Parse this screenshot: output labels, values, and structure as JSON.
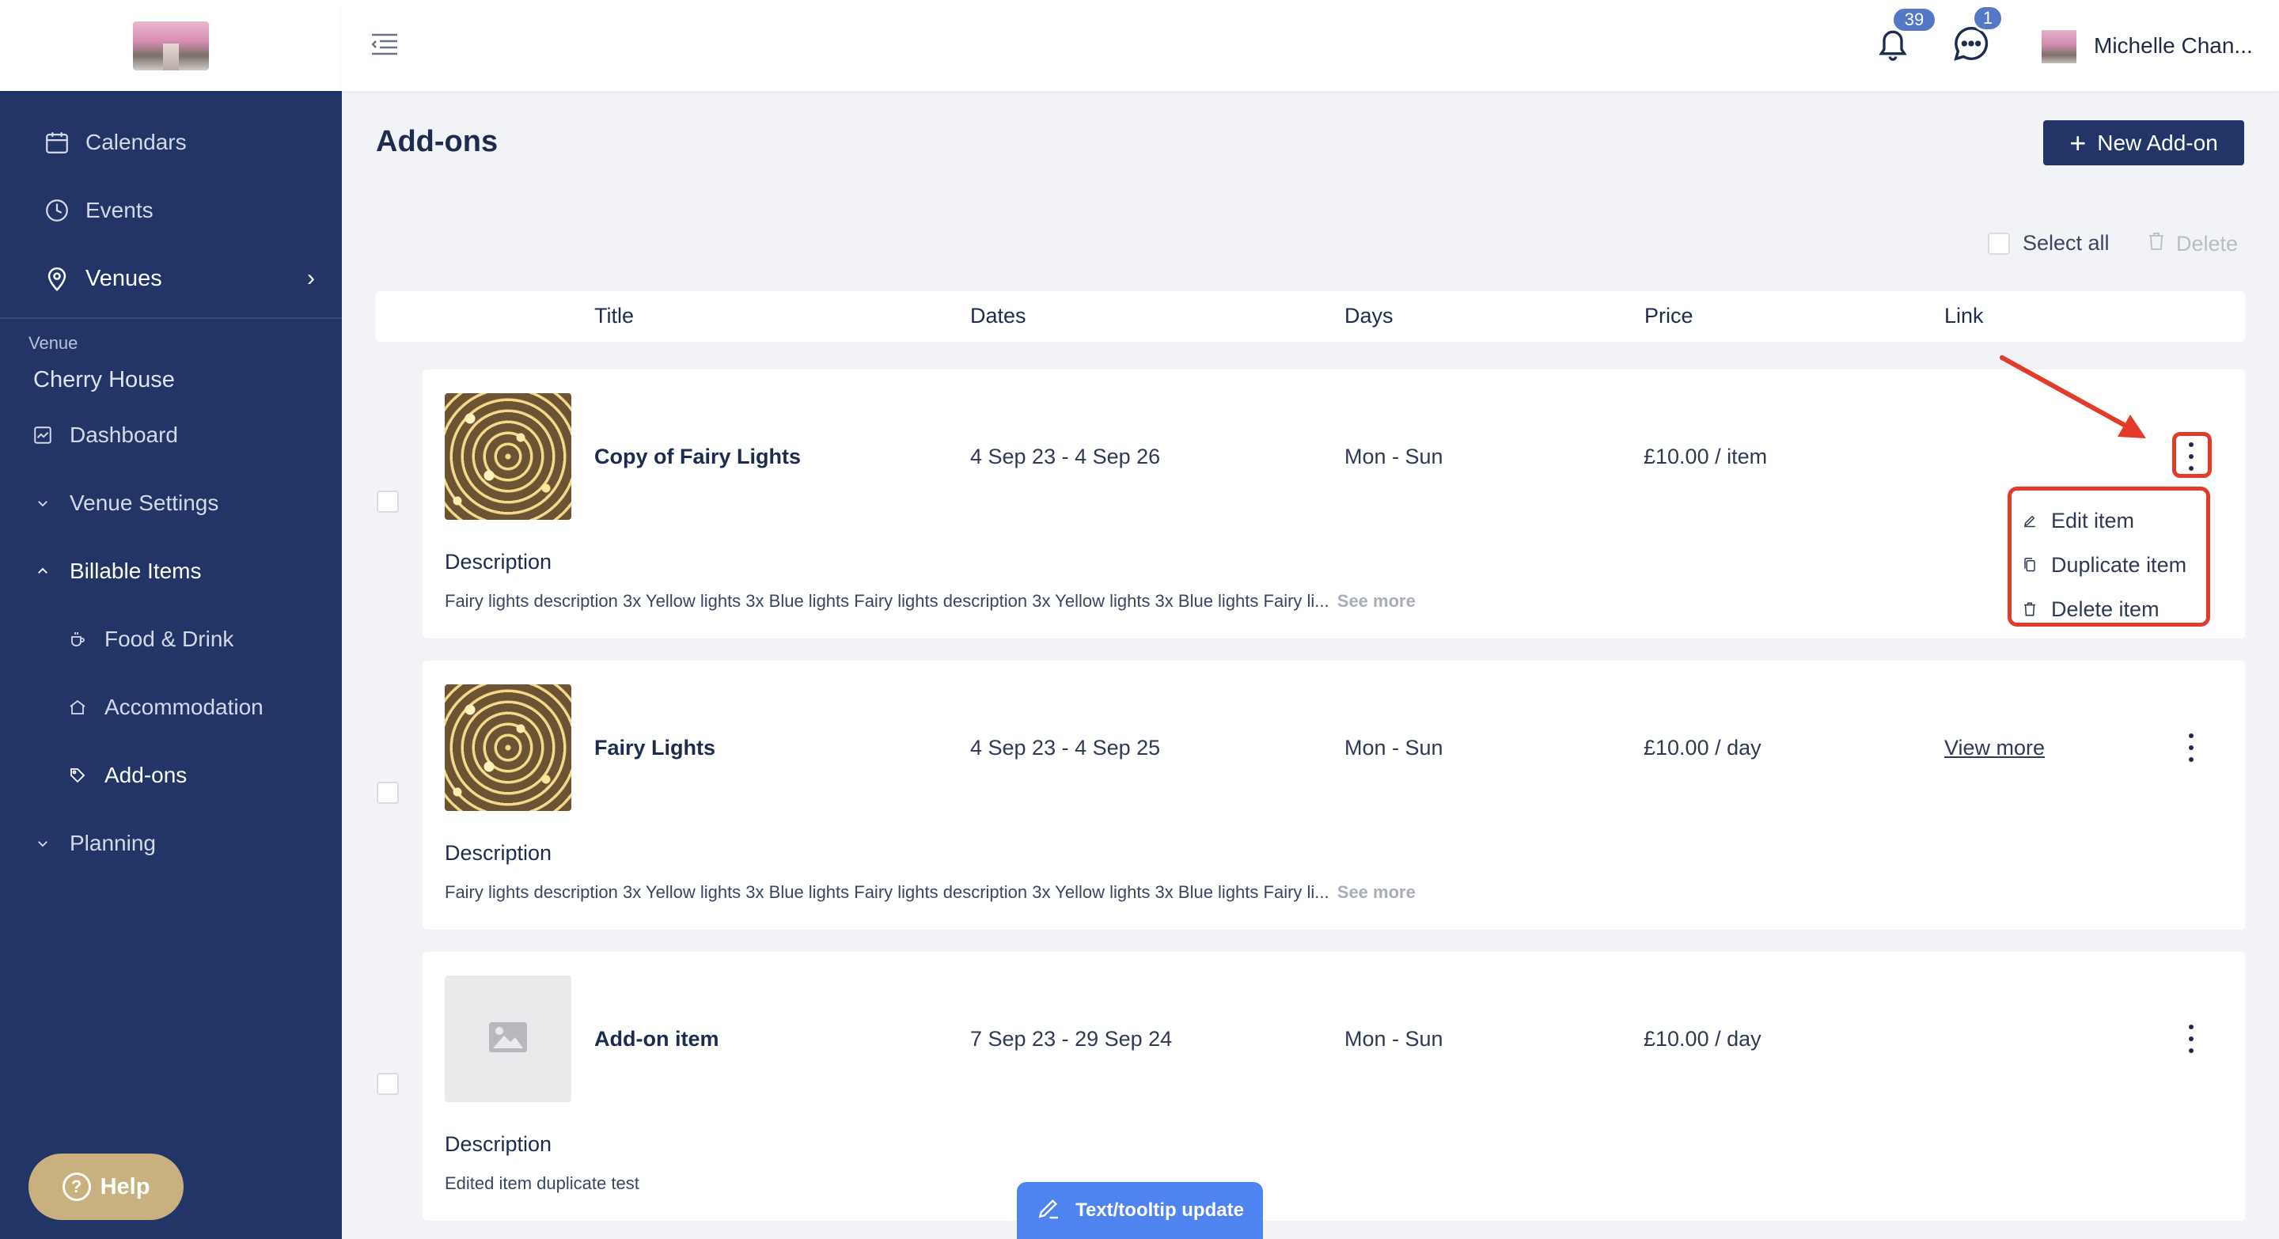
{
  "sidebar": {
    "nav": [
      {
        "label": "Calendars",
        "icon": "calendar-icon"
      },
      {
        "label": "Events",
        "icon": "clock-icon"
      },
      {
        "label": "Venues",
        "icon": "location-pin-icon"
      }
    ],
    "venue_label": "Venue",
    "venue_name": "Cherry House",
    "items": [
      {
        "label": "Dashboard",
        "icon": "chart-icon"
      },
      {
        "label": "Venue Settings",
        "icon": "chevron-down-icon"
      },
      {
        "label": "Billable Items",
        "icon": "chevron-up-icon"
      },
      {
        "label": "Food & Drink",
        "icon": "coffee-icon"
      },
      {
        "label": "Accommodation",
        "icon": "home-icon"
      },
      {
        "label": "Add-ons",
        "icon": "tag-icon"
      },
      {
        "label": "Planning",
        "icon": "chevron-down-icon"
      }
    ],
    "help_label": "Help"
  },
  "topbar": {
    "notifications_count": "39",
    "messages_count": "1",
    "user_name": "Michelle Chan..."
  },
  "page": {
    "title": "Add-ons",
    "new_button": "New Add-on",
    "select_all": "Select all",
    "delete": "Delete"
  },
  "table": {
    "columns": [
      "Title",
      "Dates",
      "Days",
      "Price",
      "Link"
    ],
    "rows": [
      {
        "title": "Copy of Fairy Lights",
        "dates": "4 Sep 23 - 4 Sep 26",
        "days": "Mon - Sun",
        "price": "£10.00 / item",
        "link": "",
        "description_label": "Description",
        "description": "Fairy lights description 3x Yellow lights 3x Blue lights Fairy lights description 3x Yellow lights 3x Blue lights Fairy li...",
        "see_more": "See more"
      },
      {
        "title": "Fairy Lights",
        "dates": "4 Sep 23 - 4 Sep 25",
        "days": "Mon - Sun",
        "price": "£10.00 / day",
        "link": "View more",
        "description_label": "Description",
        "description": "Fairy lights description 3x Yellow lights 3x Blue lights Fairy lights description 3x Yellow lights 3x Blue lights Fairy li...",
        "see_more": "See more"
      },
      {
        "title": "Add-on item",
        "dates": "7 Sep 23 - 29 Sep 24",
        "days": "Mon - Sun",
        "price": "£10.00 / day",
        "link": "",
        "description_label": "Description",
        "description": "Edited item duplicate test",
        "see_more": ""
      }
    ]
  },
  "dropdown": {
    "items": [
      {
        "label": "Edit item",
        "icon": "pencil-icon"
      },
      {
        "label": "Duplicate item",
        "icon": "copy-icon"
      },
      {
        "label": "Delete item",
        "icon": "trash-icon"
      }
    ]
  },
  "floating_pill": "Text/tooltip update",
  "colors": {
    "sidebar_bg": "#223566",
    "primary_button": "#223566",
    "annotation_red": "#e23b2a",
    "badge_blue": "#5478c6",
    "pill_blue": "#4f83f0",
    "help_gold": "#c8b07f"
  }
}
